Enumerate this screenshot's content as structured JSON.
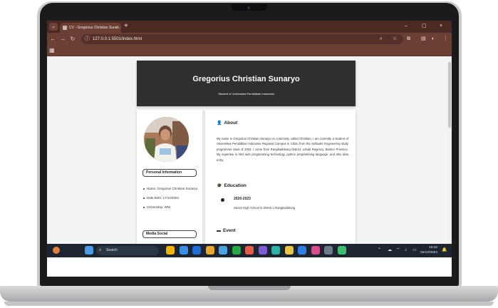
{
  "browser": {
    "tab_title": "CV - Gregorius Christian Suna...",
    "tab_close": "×",
    "new_tab": "+",
    "url": "127.0.0.1:5501/index.html",
    "window_controls": {
      "minimize": "–",
      "restore": "▢",
      "close": "×"
    },
    "icons": [
      "menu-icon",
      "favicon",
      "back-icon",
      "forward-icon",
      "reload-icon",
      "site-info-icon",
      "zoom-icon",
      "star-icon",
      "extensions-icon",
      "sidebar-icon",
      "profile-icon",
      "more-icon",
      "apps-icon"
    ]
  },
  "page": {
    "name": "Gregorius Christian Sunaryo",
    "subtitle": "Student of Universitas Pendidikan Indonesia",
    "personal_info_title": "Personal Information",
    "personal_info": [
      "Name: Gregorius Christian Sunaryo",
      "Date Birth: 17/12/2004",
      "Citizenship: WNI"
    ],
    "media_social_title": "Media Social",
    "about_title": "About",
    "about_text": "My name is Gregorius Christian Sunaryo or commonly called Christian, I am currently a student of Universitas Pendidikan Indonesia Regional Campus in Cibiru from the Software Engineering study programme class of 2023. I come from Rangkasbitung District, Lebak Regency, Banten Province. My expertise is html web programming technology, python programming language, and also data entry.",
    "education_title": "Education",
    "education": [
      {
        "years": "2020-2023",
        "school": "Senior High School in SMAN 1 Rangkasbitung"
      }
    ],
    "event_title": "Event"
  },
  "taskbar": {
    "search_placeholder": "Search",
    "time": "15:42",
    "date": "04/12/2024",
    "app_colors": [
      "#f2b400",
      "#3a8ee6",
      "#1d6fd3",
      "#e7a72e",
      "#4aa3df",
      "#28a745",
      "#e35d4a",
      "#7b5bd6",
      "#2bb3a3",
      "#e8c547",
      "#2f7de1",
      "#d94b8a",
      "#6d7a89",
      "#3dbd6f"
    ]
  }
}
